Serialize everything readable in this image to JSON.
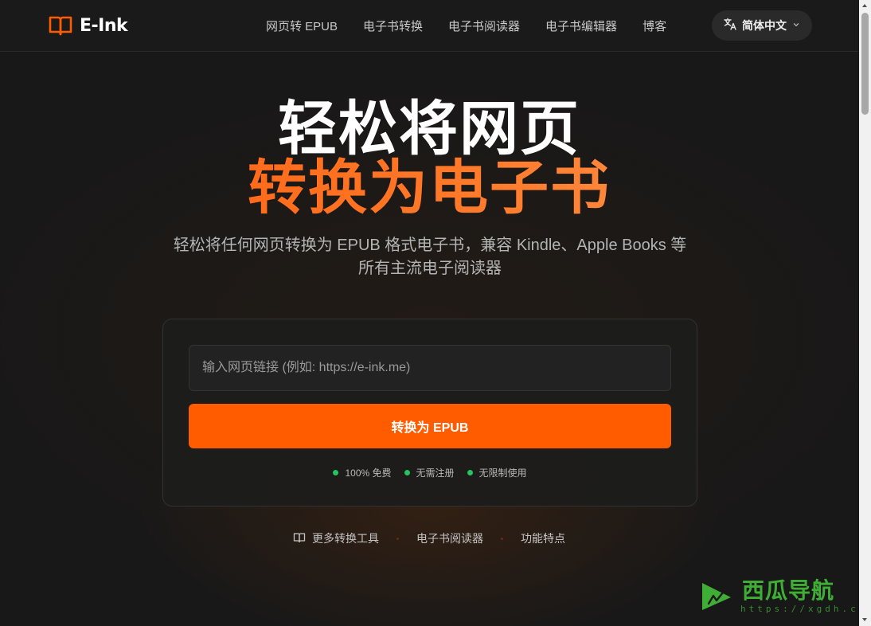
{
  "header": {
    "brand": "E-Ink",
    "nav": [
      {
        "label": "网页转 EPUB"
      },
      {
        "label": "电子书转换"
      },
      {
        "label": "电子书阅读器"
      },
      {
        "label": "电子书编辑器"
      },
      {
        "label": "博客"
      }
    ],
    "language": {
      "label": "简体中文"
    }
  },
  "hero": {
    "title_line1": "轻松将网页",
    "title_line2": "转换为电子书",
    "subtitle_line1": "轻松将任何网页转换为 EPUB 格式电子书，兼容 Kindle、Apple Books 等",
    "subtitle_line2": "所有主流电子阅读器"
  },
  "converter": {
    "url_placeholder": "输入网页链接 (例如: https://e-ink.me)",
    "url_value": "",
    "submit_label": "转换为 EPUB",
    "features": [
      {
        "label": "100% 免费"
      },
      {
        "label": "无需注册"
      },
      {
        "label": "无限制使用"
      }
    ]
  },
  "bottom_links": [
    {
      "label": "更多转换工具"
    },
    {
      "label": "电子书阅读器"
    },
    {
      "label": "功能特点"
    }
  ],
  "watermark": {
    "text": "西瓜导航",
    "url": "https://xgdh.cn"
  },
  "colors": {
    "accent": "#ff5c00",
    "background": "#181818",
    "feature_dot": "#22c55e",
    "watermark": "#3fae35"
  },
  "icons": {
    "brand": "open-book-icon",
    "language": "translate-icon",
    "dropdown": "chevron-down-icon",
    "more_tools": "book-icon"
  }
}
